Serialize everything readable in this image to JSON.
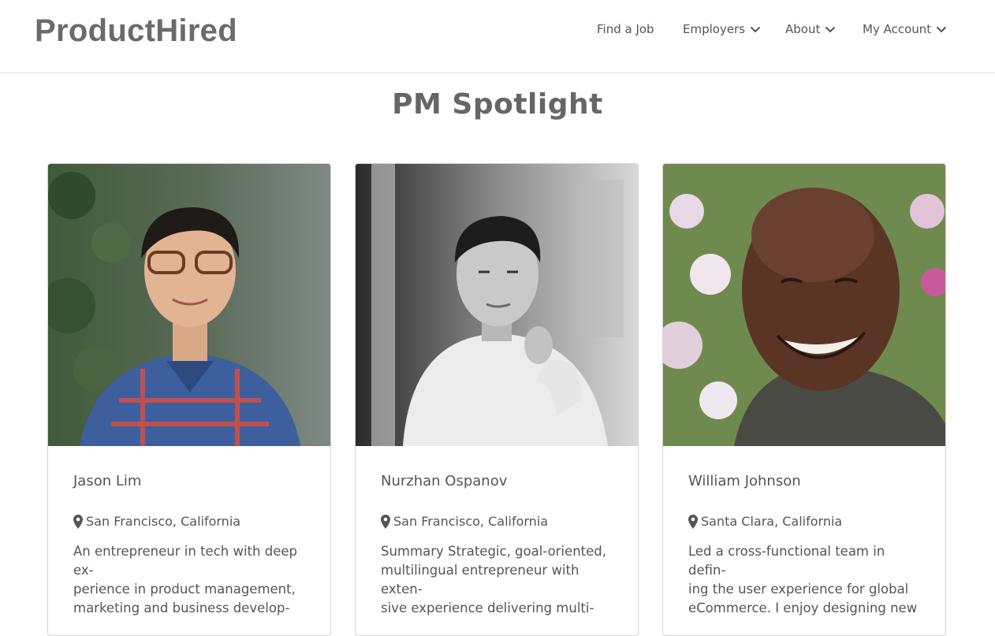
{
  "brand": {
    "logo_text": "ProductHired"
  },
  "nav": {
    "items": [
      {
        "label": "Find a Job",
        "has_dropdown": false
      },
      {
        "label": "Employers",
        "has_dropdown": true
      },
      {
        "label": "About",
        "has_dropdown": true
      },
      {
        "label": "My Account",
        "has_dropdown": true
      }
    ]
  },
  "page": {
    "title": "PM Spotlight"
  },
  "cards": [
    {
      "name": "Jason Lim",
      "location": "San Francisco, California",
      "summary_lines": [
        "An entrepreneur in tech with deep ex-",
        "perience in product management,",
        "marketing and business develop-"
      ]
    },
    {
      "name": "Nurzhan Ospanov",
      "location": "San Francisco, California",
      "summary_lines": [
        "Summary Strategic, goal-oriented,",
        "multilingual entrepreneur with exten-",
        "sive experience delivering multi-"
      ]
    },
    {
      "name": "William Johnson",
      "location": "Santa Clara, California",
      "summary_lines": [
        "Led a cross-functional team in defin-",
        "ing the user experience for global",
        "eCommerce. I enjoy designing new"
      ]
    }
  ],
  "colors": {
    "text": "#555555",
    "logo": "#6b6b6b",
    "border": "#d5d5d5"
  },
  "icons": {
    "dropdown": "chevron-down-icon",
    "location": "map-marker-icon"
  }
}
